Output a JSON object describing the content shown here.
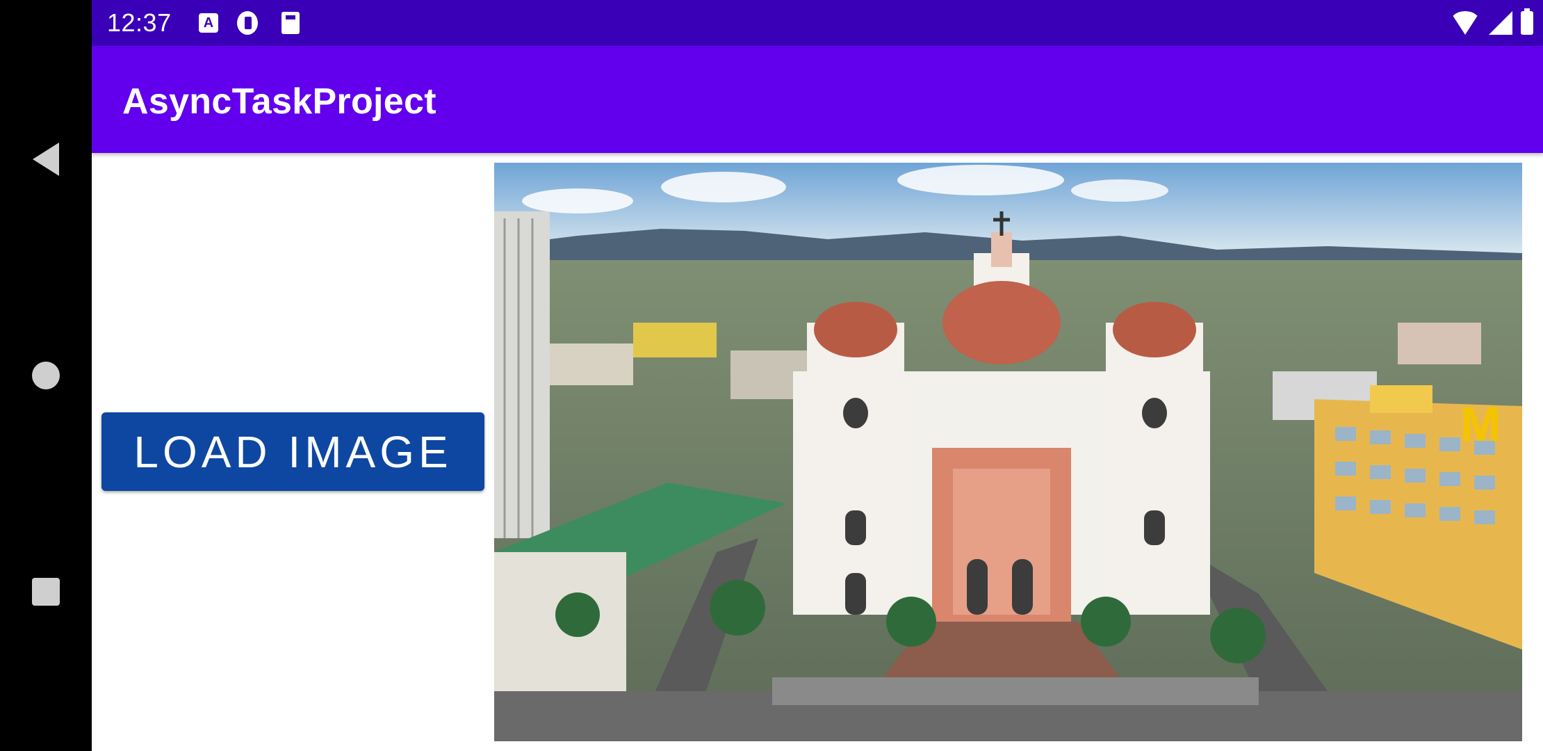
{
  "status_bar": {
    "time": "12:37",
    "left_icons": [
      "a-box-icon",
      "r-circle-icon",
      "sd-card-icon"
    ],
    "right_icons": [
      "wifi-icon",
      "signal-icon",
      "battery-icon"
    ]
  },
  "app_bar": {
    "title": "AsyncTaskProject"
  },
  "content": {
    "load_button_label": "LOAD IMAGE",
    "image_alt": "Aerial photo of a cathedral with domes in a city"
  },
  "navigation": [
    "back-icon",
    "home-icon",
    "recents-icon"
  ],
  "colors": {
    "status_bar": "#3a00b7",
    "app_bar": "#6200ee",
    "button": "#0d47a1",
    "nav_bar": "#000000"
  }
}
